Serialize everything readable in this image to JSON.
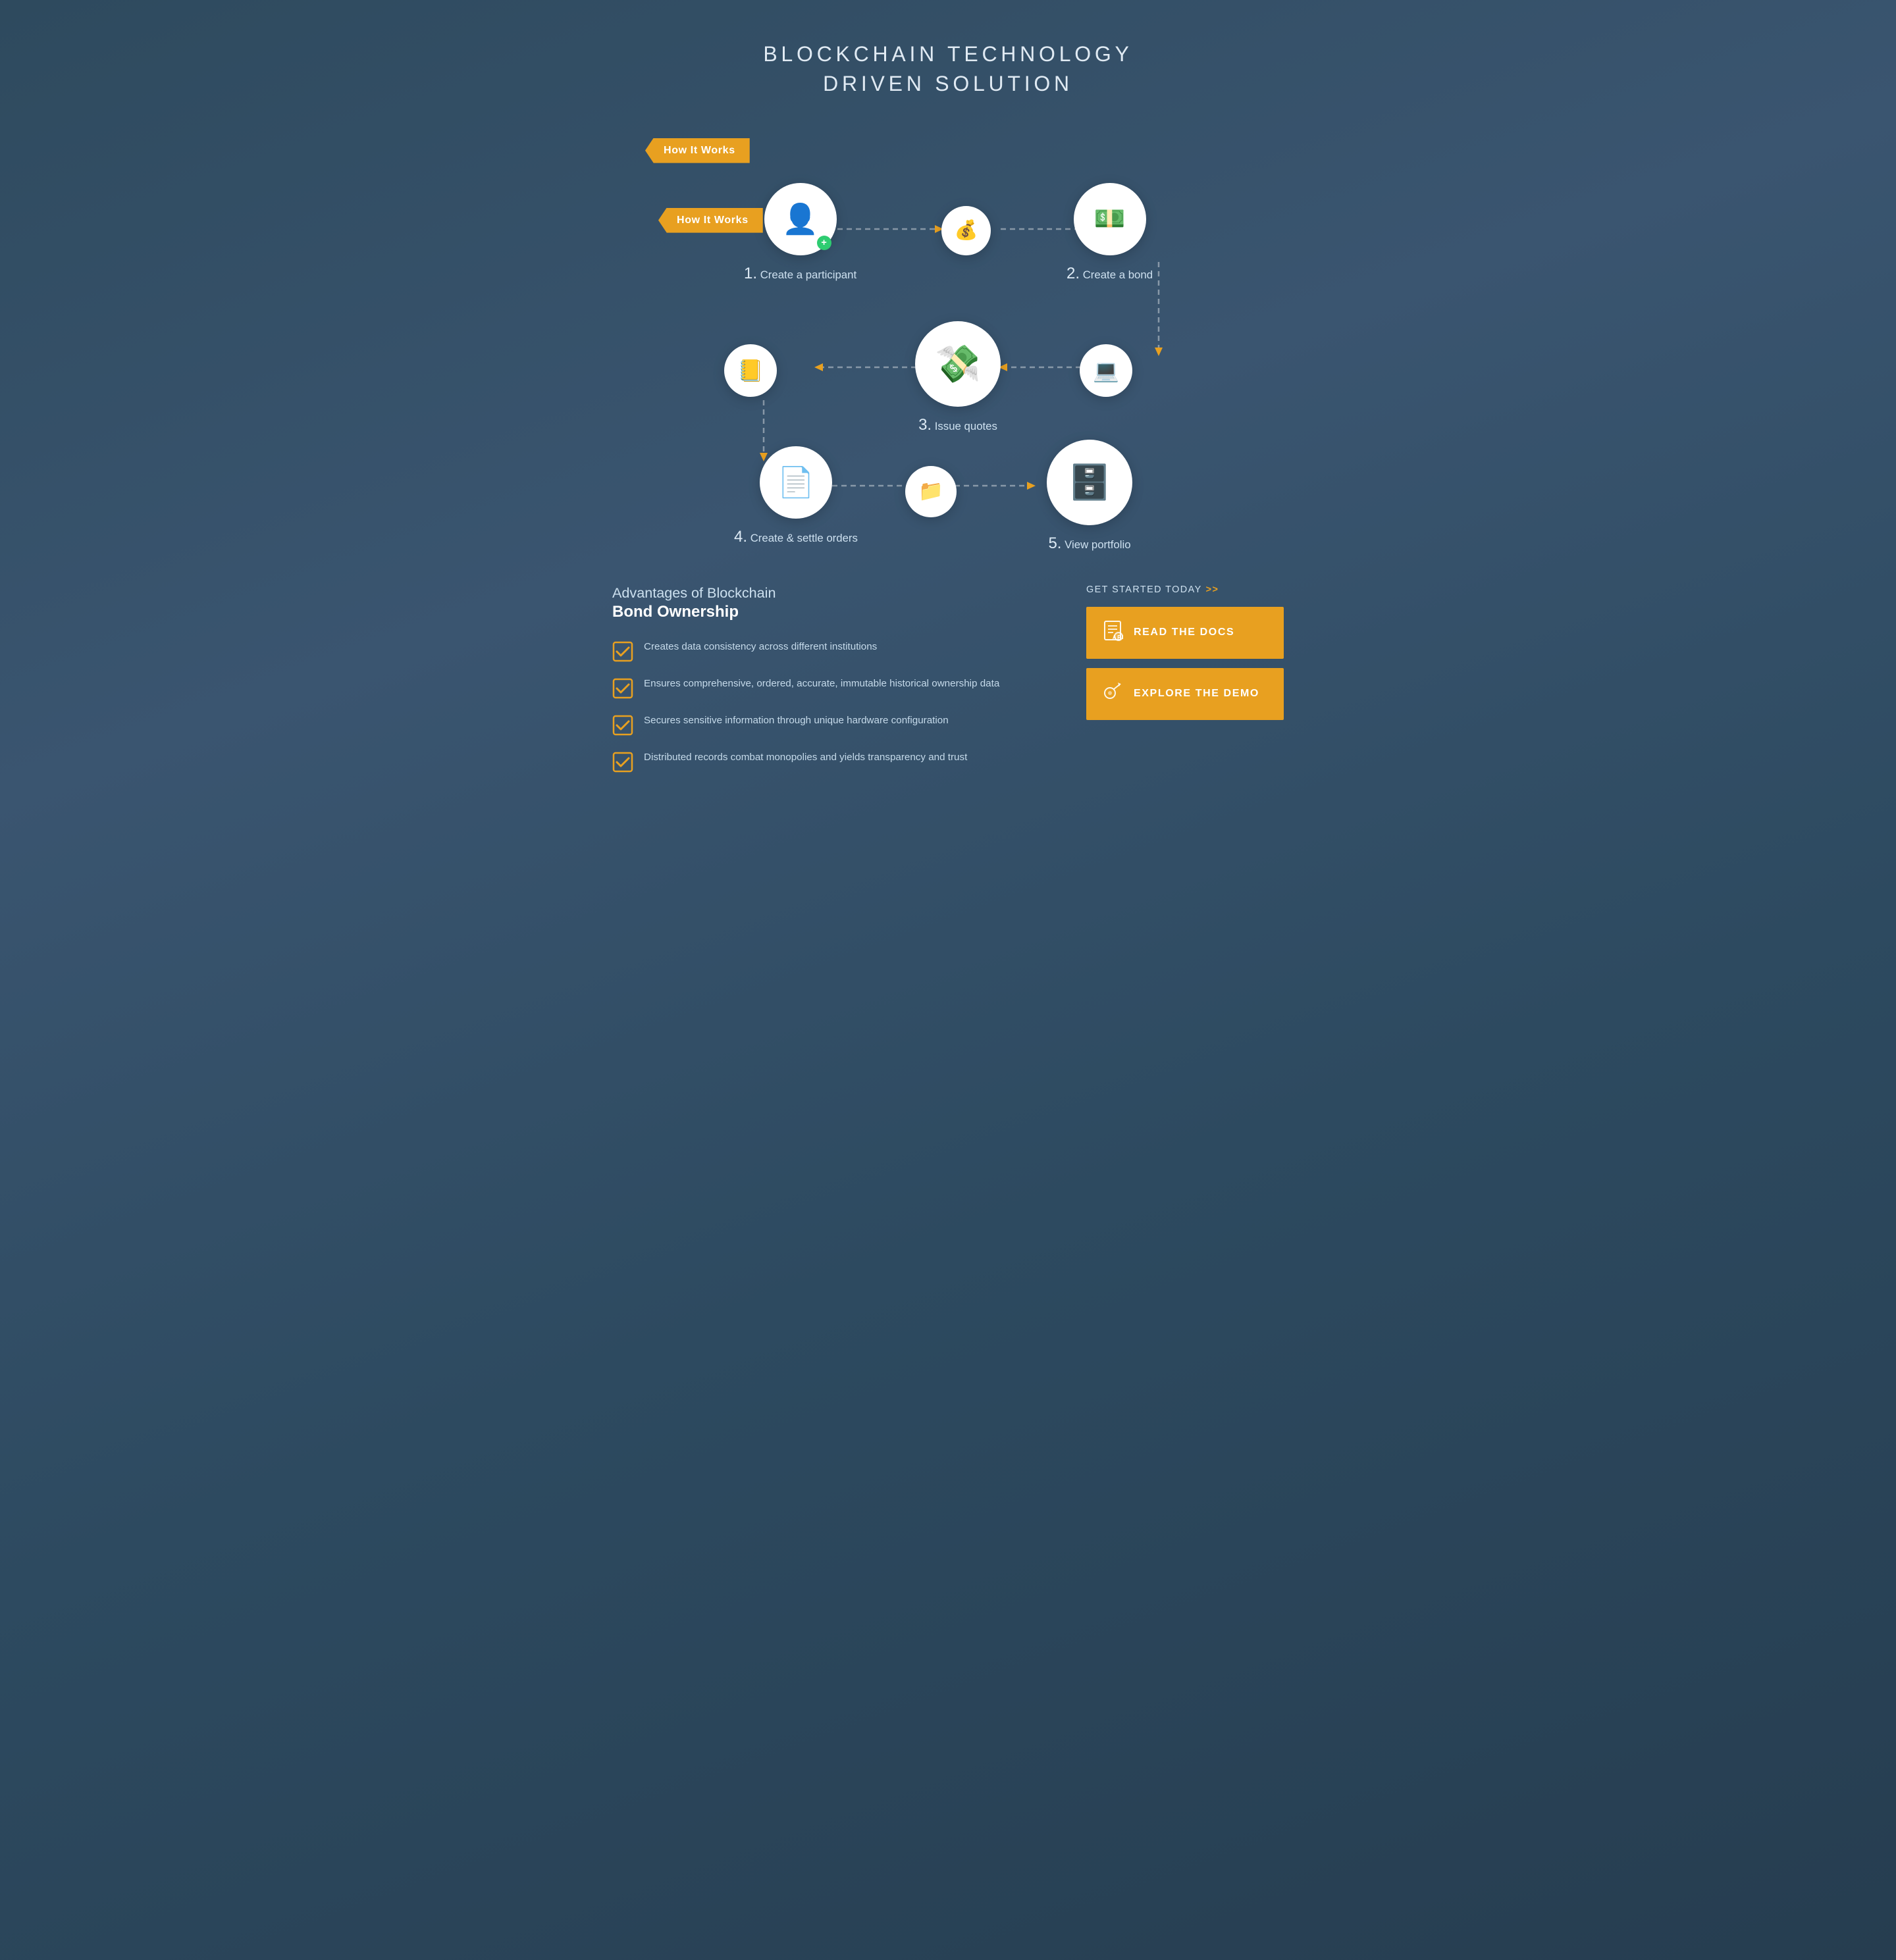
{
  "header": {
    "line1": "BLOCKCHAIN TECHNOLOGY",
    "line2": "DRIVEN SOLUTION"
  },
  "how_it_works": {
    "badge": "How It Works",
    "steps": [
      {
        "num": "1",
        "label": "Create a participant",
        "icon": "👤"
      },
      {
        "num": "2",
        "label": "Create a bond",
        "icon": "💵"
      },
      {
        "num": "3",
        "label": "Issue quotes",
        "icon": "💸"
      },
      {
        "num": "4",
        "label": "Create & settle orders",
        "icon": "📄"
      },
      {
        "num": "5",
        "label": "View portfolio",
        "icon": "🗄️"
      }
    ],
    "small_circles": [
      {
        "icon": "📋"
      },
      {
        "icon": "🗂️"
      },
      {
        "icon": "💻"
      }
    ]
  },
  "advantages": {
    "subtitle": "Advantages of Blockchain",
    "title": "Bond Ownership",
    "items": [
      {
        "text": "Creates data consistency across different institutions"
      },
      {
        "text": "Ensures comprehensive, ordered, accurate, immutable historical ownership data"
      },
      {
        "text": "Secures sensitive information through unique hardware configuration"
      },
      {
        "text": "Distributed records combat monopolies and yields transparency and trust"
      }
    ]
  },
  "cta": {
    "label": "GET STARTED TODAY",
    "chevrons": ">>",
    "buttons": [
      {
        "label": "READ THE DOCS",
        "icon": "⚙️"
      },
      {
        "label": "EXPLORE THE DEMO",
        "icon": "🖱️"
      }
    ]
  }
}
